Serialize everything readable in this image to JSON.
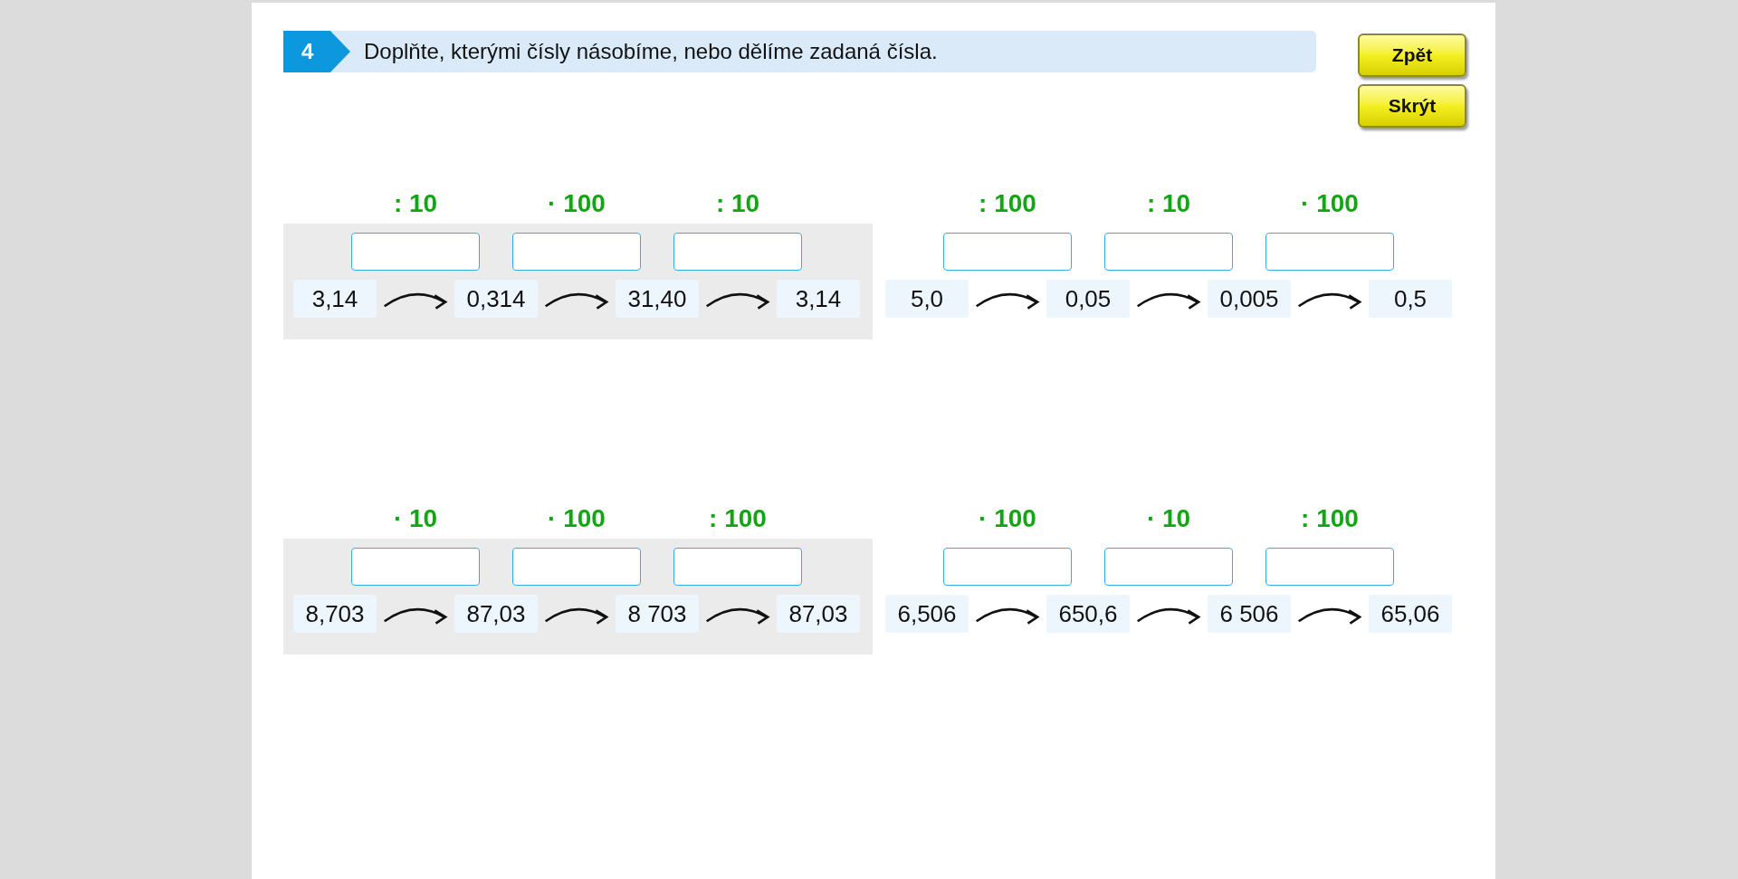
{
  "task": {
    "number": "4",
    "text": "Doplňte, kterými čísly násobíme, nebo dělíme zadaná čísla."
  },
  "buttons": [
    {
      "label": "Zpět"
    },
    {
      "label": "Skrýt"
    }
  ],
  "exercises": [
    {
      "highlighted": true,
      "operations": [
        ": 10",
        "· 100",
        ": 10"
      ],
      "numbers": [
        "3,14",
        "0,314",
        "31,40",
        "3,14"
      ]
    },
    {
      "highlighted": false,
      "operations": [
        ": 100",
        ": 10",
        "· 100"
      ],
      "numbers": [
        "5,0",
        "0,05",
        "0,005",
        "0,5"
      ]
    },
    {
      "highlighted": true,
      "operations": [
        "· 10",
        "· 100",
        ": 100"
      ],
      "numbers": [
        "8,703",
        "87,03",
        "8 703",
        "87,03"
      ]
    },
    {
      "highlighted": false,
      "operations": [
        "· 100",
        "· 10",
        ": 100"
      ],
      "numbers": [
        "6,506",
        "650,6",
        "6 506",
        "65,06"
      ]
    }
  ]
}
